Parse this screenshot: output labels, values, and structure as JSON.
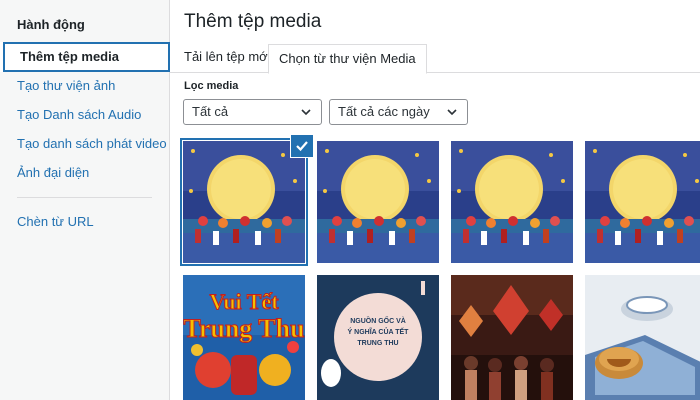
{
  "sidebar": {
    "heading": "Hành động",
    "items": [
      {
        "label": "Thêm tệp media",
        "active": true
      },
      {
        "label": "Tạo thư viện ảnh"
      },
      {
        "label": "Tạo Danh sách Audio"
      },
      {
        "label": "Tạo danh sách phát video"
      },
      {
        "label": "Ảnh đại diện"
      }
    ],
    "url_item": "Chèn từ URL"
  },
  "main": {
    "title": "Thêm tệp media",
    "tabs": [
      {
        "label": "Tải lên tệp mới"
      },
      {
        "label": "Chọn từ thư viện Media",
        "active": true
      }
    ],
    "filter": {
      "label": "Lọc media",
      "type_select": "Tất cả",
      "date_select": "Tất cả các ngày"
    },
    "grid": {
      "items": [
        {
          "name": "moon-festival-image",
          "selected": true
        },
        {
          "name": "moon-festival-image"
        },
        {
          "name": "moon-festival-image"
        },
        {
          "name": "moon-festival-image"
        },
        {
          "name": "vui-tet-trung-thu-image",
          "text": "Vui Tết Trung Thu"
        },
        {
          "name": "nguon-goc-image",
          "text": "NGUỒN GỐC VÀ Ý NGHĨA CỦA TẾT TRUNG THU"
        },
        {
          "name": "lantern-parade-image"
        },
        {
          "name": "mooncake-image"
        }
      ]
    }
  },
  "colors": {
    "accent": "#2271b1",
    "sidebar_bg": "#f6f7f7",
    "border": "#dcdcde"
  }
}
